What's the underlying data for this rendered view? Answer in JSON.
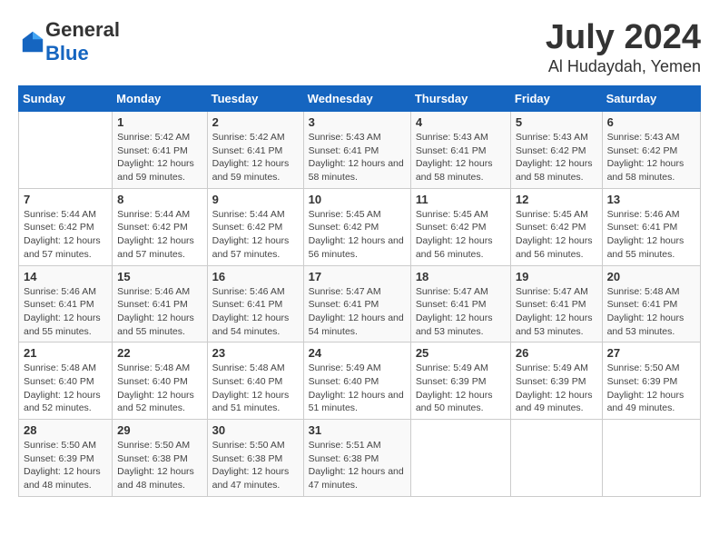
{
  "logo": {
    "general": "General",
    "blue": "Blue"
  },
  "title": "July 2024",
  "subtitle": "Al Hudaydah, Yemen",
  "days_of_week": [
    "Sunday",
    "Monday",
    "Tuesday",
    "Wednesday",
    "Thursday",
    "Friday",
    "Saturday"
  ],
  "weeks": [
    [
      {
        "num": "",
        "sunrise": "",
        "sunset": "",
        "daylight": ""
      },
      {
        "num": "1",
        "sunrise": "Sunrise: 5:42 AM",
        "sunset": "Sunset: 6:41 PM",
        "daylight": "Daylight: 12 hours and 59 minutes."
      },
      {
        "num": "2",
        "sunrise": "Sunrise: 5:42 AM",
        "sunset": "Sunset: 6:41 PM",
        "daylight": "Daylight: 12 hours and 59 minutes."
      },
      {
        "num": "3",
        "sunrise": "Sunrise: 5:43 AM",
        "sunset": "Sunset: 6:41 PM",
        "daylight": "Daylight: 12 hours and 58 minutes."
      },
      {
        "num": "4",
        "sunrise": "Sunrise: 5:43 AM",
        "sunset": "Sunset: 6:41 PM",
        "daylight": "Daylight: 12 hours and 58 minutes."
      },
      {
        "num": "5",
        "sunrise": "Sunrise: 5:43 AM",
        "sunset": "Sunset: 6:42 PM",
        "daylight": "Daylight: 12 hours and 58 minutes."
      },
      {
        "num": "6",
        "sunrise": "Sunrise: 5:43 AM",
        "sunset": "Sunset: 6:42 PM",
        "daylight": "Daylight: 12 hours and 58 minutes."
      }
    ],
    [
      {
        "num": "7",
        "sunrise": "Sunrise: 5:44 AM",
        "sunset": "Sunset: 6:42 PM",
        "daylight": "Daylight: 12 hours and 57 minutes."
      },
      {
        "num": "8",
        "sunrise": "Sunrise: 5:44 AM",
        "sunset": "Sunset: 6:42 PM",
        "daylight": "Daylight: 12 hours and 57 minutes."
      },
      {
        "num": "9",
        "sunrise": "Sunrise: 5:44 AM",
        "sunset": "Sunset: 6:42 PM",
        "daylight": "Daylight: 12 hours and 57 minutes."
      },
      {
        "num": "10",
        "sunrise": "Sunrise: 5:45 AM",
        "sunset": "Sunset: 6:42 PM",
        "daylight": "Daylight: 12 hours and 56 minutes."
      },
      {
        "num": "11",
        "sunrise": "Sunrise: 5:45 AM",
        "sunset": "Sunset: 6:42 PM",
        "daylight": "Daylight: 12 hours and 56 minutes."
      },
      {
        "num": "12",
        "sunrise": "Sunrise: 5:45 AM",
        "sunset": "Sunset: 6:42 PM",
        "daylight": "Daylight: 12 hours and 56 minutes."
      },
      {
        "num": "13",
        "sunrise": "Sunrise: 5:46 AM",
        "sunset": "Sunset: 6:41 PM",
        "daylight": "Daylight: 12 hours and 55 minutes."
      }
    ],
    [
      {
        "num": "14",
        "sunrise": "Sunrise: 5:46 AM",
        "sunset": "Sunset: 6:41 PM",
        "daylight": "Daylight: 12 hours and 55 minutes."
      },
      {
        "num": "15",
        "sunrise": "Sunrise: 5:46 AM",
        "sunset": "Sunset: 6:41 PM",
        "daylight": "Daylight: 12 hours and 55 minutes."
      },
      {
        "num": "16",
        "sunrise": "Sunrise: 5:46 AM",
        "sunset": "Sunset: 6:41 PM",
        "daylight": "Daylight: 12 hours and 54 minutes."
      },
      {
        "num": "17",
        "sunrise": "Sunrise: 5:47 AM",
        "sunset": "Sunset: 6:41 PM",
        "daylight": "Daylight: 12 hours and 54 minutes."
      },
      {
        "num": "18",
        "sunrise": "Sunrise: 5:47 AM",
        "sunset": "Sunset: 6:41 PM",
        "daylight": "Daylight: 12 hours and 53 minutes."
      },
      {
        "num": "19",
        "sunrise": "Sunrise: 5:47 AM",
        "sunset": "Sunset: 6:41 PM",
        "daylight": "Daylight: 12 hours and 53 minutes."
      },
      {
        "num": "20",
        "sunrise": "Sunrise: 5:48 AM",
        "sunset": "Sunset: 6:41 PM",
        "daylight": "Daylight: 12 hours and 53 minutes."
      }
    ],
    [
      {
        "num": "21",
        "sunrise": "Sunrise: 5:48 AM",
        "sunset": "Sunset: 6:40 PM",
        "daylight": "Daylight: 12 hours and 52 minutes."
      },
      {
        "num": "22",
        "sunrise": "Sunrise: 5:48 AM",
        "sunset": "Sunset: 6:40 PM",
        "daylight": "Daylight: 12 hours and 52 minutes."
      },
      {
        "num": "23",
        "sunrise": "Sunrise: 5:48 AM",
        "sunset": "Sunset: 6:40 PM",
        "daylight": "Daylight: 12 hours and 51 minutes."
      },
      {
        "num": "24",
        "sunrise": "Sunrise: 5:49 AM",
        "sunset": "Sunset: 6:40 PM",
        "daylight": "Daylight: 12 hours and 51 minutes."
      },
      {
        "num": "25",
        "sunrise": "Sunrise: 5:49 AM",
        "sunset": "Sunset: 6:39 PM",
        "daylight": "Daylight: 12 hours and 50 minutes."
      },
      {
        "num": "26",
        "sunrise": "Sunrise: 5:49 AM",
        "sunset": "Sunset: 6:39 PM",
        "daylight": "Daylight: 12 hours and 49 minutes."
      },
      {
        "num": "27",
        "sunrise": "Sunrise: 5:50 AM",
        "sunset": "Sunset: 6:39 PM",
        "daylight": "Daylight: 12 hours and 49 minutes."
      }
    ],
    [
      {
        "num": "28",
        "sunrise": "Sunrise: 5:50 AM",
        "sunset": "Sunset: 6:39 PM",
        "daylight": "Daylight: 12 hours and 48 minutes."
      },
      {
        "num": "29",
        "sunrise": "Sunrise: 5:50 AM",
        "sunset": "Sunset: 6:38 PM",
        "daylight": "Daylight: 12 hours and 48 minutes."
      },
      {
        "num": "30",
        "sunrise": "Sunrise: 5:50 AM",
        "sunset": "Sunset: 6:38 PM",
        "daylight": "Daylight: 12 hours and 47 minutes."
      },
      {
        "num": "31",
        "sunrise": "Sunrise: 5:51 AM",
        "sunset": "Sunset: 6:38 PM",
        "daylight": "Daylight: 12 hours and 47 minutes."
      },
      {
        "num": "",
        "sunrise": "",
        "sunset": "",
        "daylight": ""
      },
      {
        "num": "",
        "sunrise": "",
        "sunset": "",
        "daylight": ""
      },
      {
        "num": "",
        "sunrise": "",
        "sunset": "",
        "daylight": ""
      }
    ]
  ]
}
